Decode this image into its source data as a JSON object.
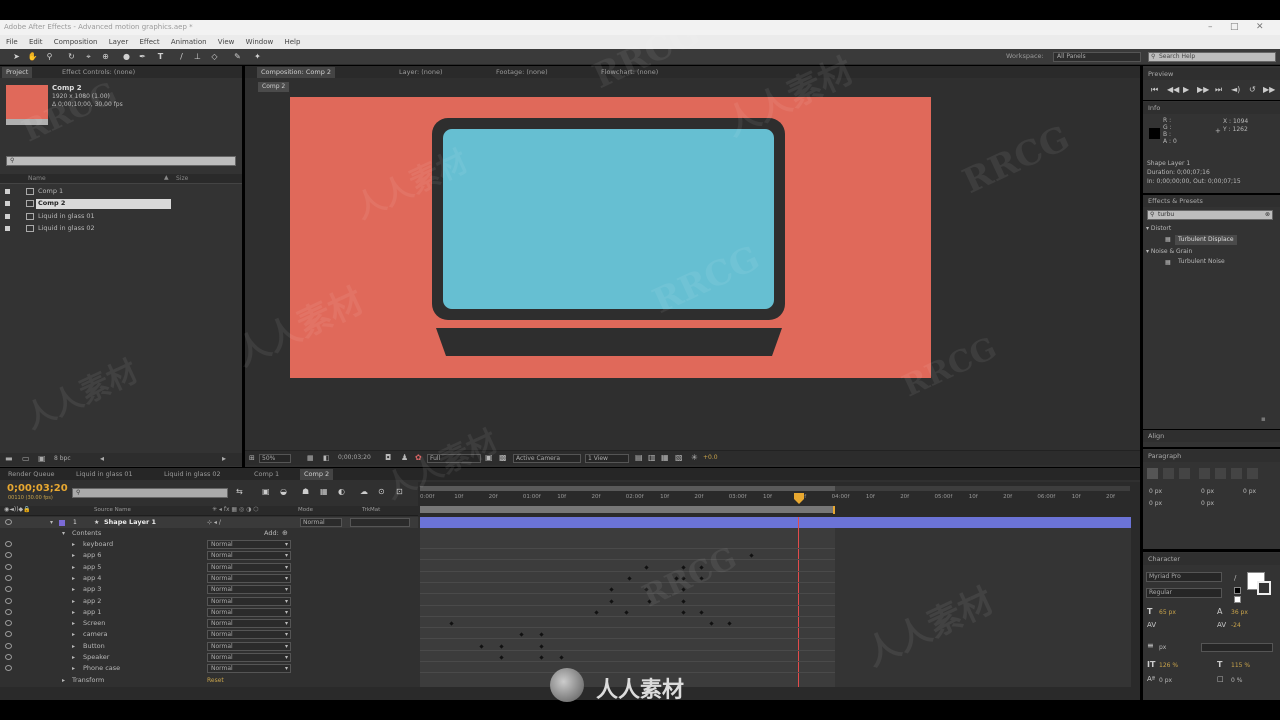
{
  "window": {
    "title": "Adobe After Effects - Advanced motion graphics.aep *"
  },
  "menu": [
    "File",
    "Edit",
    "Composition",
    "Layer",
    "Effect",
    "Animation",
    "View",
    "Window",
    "Help"
  ],
  "toolbar": {
    "workspace_label": "Workspace:",
    "workspace_value": "All Panels",
    "search_help_placeholder": "Search Help"
  },
  "project": {
    "tab_project": "Project",
    "tab_effect_controls": "Effect Controls: (none)",
    "selected_name": "Comp 2",
    "selected_dims": "1920 x 1080 (1.00)",
    "selected_duration": "Δ 0;00;10;00, 30.00 fps",
    "col_name": "Name",
    "col_size": "Size",
    "items": [
      "Comp 1",
      "Comp 2",
      "Liquid in glass 01",
      "Liquid in glass 02"
    ],
    "bpc": "8 bpc"
  },
  "viewer": {
    "tab_composition": "Composition: Comp 2",
    "tab_layer": "Layer: (none)",
    "tab_footage": "Footage: (none)",
    "tab_flowchart": "Flowchart: (none)",
    "breadcrumb": "Comp 2",
    "zoom": "50%",
    "timecode": "0;00;03;20",
    "resolution": "Full",
    "camera": "Active Camera",
    "views": "1 View",
    "exposure": "+0.0",
    "colors": {
      "background": "#e0695a",
      "screen": "#66bfd2",
      "frame": "#2e2e2e"
    }
  },
  "timeline": {
    "tabs": [
      "Render Queue",
      "Liquid in glass 01",
      "Liquid in glass 02",
      "Comp 1",
      "Comp 2"
    ],
    "current_time": "0;00;03;20",
    "time_sub": "00110 (30.00 fps)",
    "col_source_name": "Source Name",
    "col_mode": "Mode",
    "col_trkmat": "TrkMat",
    "layer": {
      "index": "1",
      "name": "Shape Layer 1",
      "mode": "Normal"
    },
    "contents_label": "Contents",
    "add_label": "Add:",
    "groups": [
      {
        "name": "keyboard",
        "mode": "Normal"
      },
      {
        "name": "app 6",
        "mode": "Normal"
      },
      {
        "name": "app 5",
        "mode": "Normal"
      },
      {
        "name": "app 4",
        "mode": "Normal"
      },
      {
        "name": "app 3",
        "mode": "Normal"
      },
      {
        "name": "app 2",
        "mode": "Normal"
      },
      {
        "name": "app 1",
        "mode": "Normal"
      },
      {
        "name": "Screen",
        "mode": "Normal"
      },
      {
        "name": "camera",
        "mode": "Normal"
      },
      {
        "name": "Button",
        "mode": "Normal"
      },
      {
        "name": "Speaker",
        "mode": "Normal"
      },
      {
        "name": "Phone case",
        "mode": "Normal"
      }
    ],
    "transform_label": "Transform",
    "transform_value": "Reset",
    "ruler": [
      "0:00f",
      "10f",
      "20f",
      "01:00f",
      "10f",
      "20f",
      "02:00f",
      "10f",
      "20f",
      "03:00f",
      "10f",
      "20f",
      "04:00f",
      "10f",
      "20f",
      "05:00f",
      "10f",
      "20f",
      "06:00f",
      "10f",
      "20f"
    ]
  },
  "preview": {
    "tab": "Preview"
  },
  "info": {
    "tab": "Info",
    "r": "R :",
    "g": "G :",
    "b": "B :",
    "a": "A : 0",
    "x": "X : 1094",
    "y": "Y : 1262",
    "layer_name": "Shape Layer 1",
    "duration": "Duration: 0;00;07;16",
    "in_out": "In: 0;00;00;00, Out: 0;00;07;15"
  },
  "effects": {
    "tab": "Effects & Presets",
    "search_value": "turbu",
    "cat1": "Distort",
    "cat1_item": "Turbulent Displace",
    "cat2": "Noise & Grain",
    "cat2_item": "Turbulent Noise"
  },
  "align": {
    "tab": "Align"
  },
  "paragraph": {
    "tab": "Paragraph",
    "px1": "0 px",
    "px2": "0 px",
    "px3": "0 px",
    "px4": "0 px",
    "px5": "0 px"
  },
  "character": {
    "tab": "Character",
    "font": "Myriad Pro",
    "style": "Regular",
    "size": "65 px",
    "leading": "36 px",
    "tracking": "-24",
    "stroke": "px",
    "vscale": "126 %",
    "hscale": "115 %",
    "baseline": "0 px",
    "tsume": "0 %"
  },
  "watermarks": [
    "RRCG",
    "人人素材",
    "RRCG",
    "人人素材",
    "RRCG",
    "人人素材",
    "RRCG",
    "人人素材",
    "RRCG",
    "人人素材",
    "RRCG",
    "人人素材"
  ],
  "logo_text": "人人素材"
}
